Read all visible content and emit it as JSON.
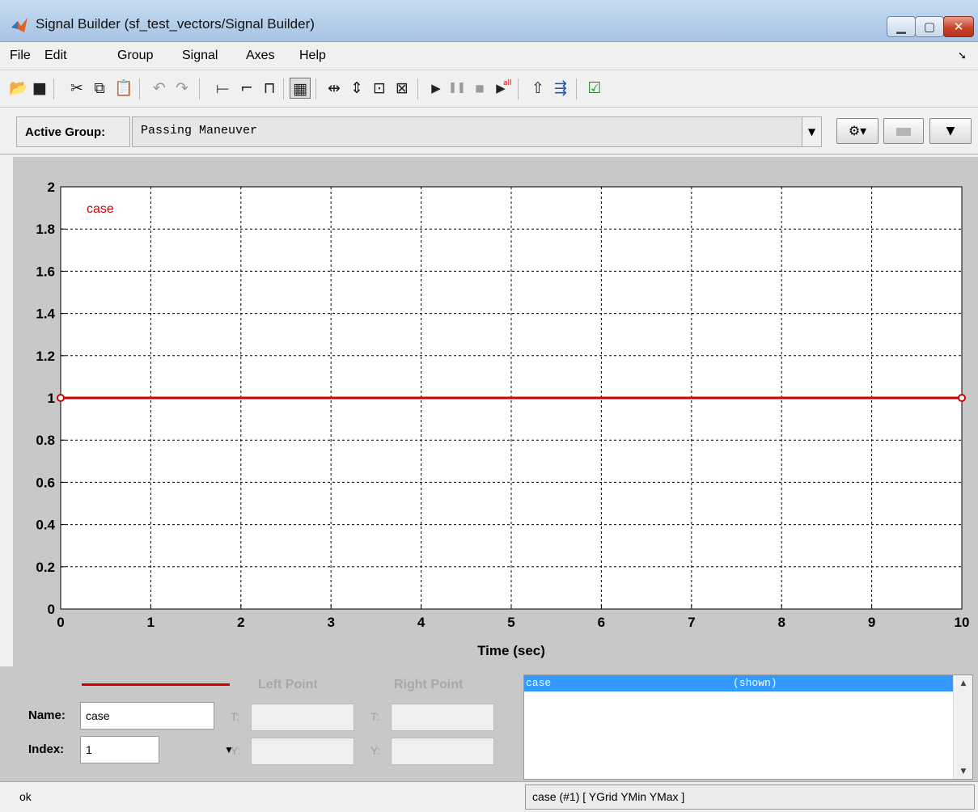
{
  "window": {
    "title": "Signal Builder (sf_test_vectors/Signal Builder)",
    "controls": [
      "minimize",
      "maximize",
      "close"
    ]
  },
  "menu": [
    "File",
    "Edit",
    "Group",
    "Signal",
    "Axes",
    "Help"
  ],
  "toolbar": {
    "icons": [
      "open-icon",
      "save-icon",
      "cut-icon",
      "copy-icon",
      "paste-icon",
      "undo-icon",
      "redo-icon",
      "constant-signal-icon",
      "step-signal-icon",
      "pulse-signal-icon",
      "grid-toggle-icon",
      "zoom-time-icon",
      "zoom-y-icon",
      "zoom-xy-icon",
      "zoom-fit-icon",
      "play-icon",
      "pause-icon",
      "stop-icon",
      "play-all-icon",
      "move-up-icon",
      "export-icon",
      "verify-icon"
    ]
  },
  "active_group": {
    "label": "Active Group:",
    "value": "Passing Maneuver"
  },
  "chart_data": {
    "type": "line",
    "series": [
      {
        "name": "case",
        "x": [
          0,
          10
        ],
        "y": [
          1,
          1
        ],
        "color": "#d00000"
      }
    ],
    "annotation": "case",
    "xlabel": "Time (sec)",
    "ylabel": "",
    "xlim": [
      0,
      10
    ],
    "ylim": [
      0,
      2
    ],
    "x_ticks": [
      "0",
      "1",
      "2",
      "3",
      "4",
      "5",
      "6",
      "7",
      "8",
      "9",
      "10"
    ],
    "y_ticks": [
      "0",
      "0.2",
      "0.4",
      "0.6",
      "0.8",
      "1",
      "1.2",
      "1.4",
      "1.6",
      "1.8",
      "2"
    ],
    "grid": true
  },
  "editor": {
    "left_point_header": "Left Point",
    "right_point_header": "Right Point",
    "name_label": "Name:",
    "name_value": "case",
    "index_label": "Index:",
    "index_value": "1",
    "t_label": "T:",
    "y_label": "Y:",
    "signal_list": [
      {
        "name": "case",
        "status": "(shown)"
      }
    ]
  },
  "status": {
    "text": "ok",
    "signal_info": "case (#1)  [ YGrid YMin YMax ]"
  }
}
